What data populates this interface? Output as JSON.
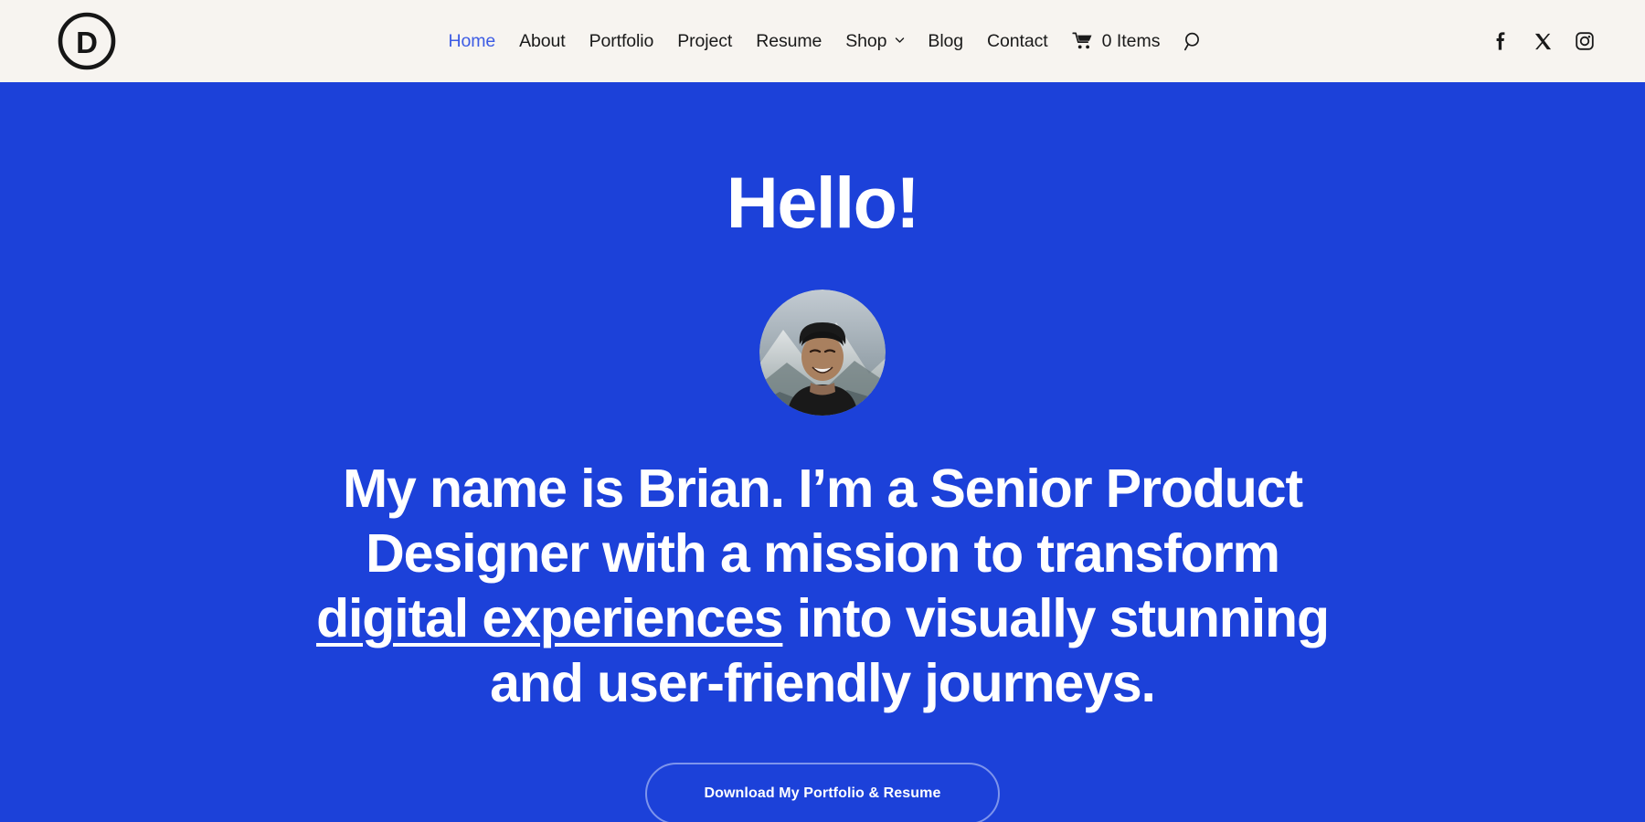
{
  "theme": {
    "hero_bg": "#1C41D9",
    "header_bg": "#F7F4F0",
    "accent_link": "#3D5CE4",
    "text_dark": "#1A1A1A",
    "text_light": "#FFFFFF",
    "cta_border": "#7D94EC"
  },
  "header": {
    "logo": {
      "name": "circle-d-logo",
      "letter": "D"
    },
    "nav_items": [
      {
        "label": "Home",
        "active": true,
        "has_dropdown": false
      },
      {
        "label": "About",
        "active": false,
        "has_dropdown": false
      },
      {
        "label": "Portfolio",
        "active": false,
        "has_dropdown": false
      },
      {
        "label": "Project",
        "active": false,
        "has_dropdown": false
      },
      {
        "label": "Resume",
        "active": false,
        "has_dropdown": false
      },
      {
        "label": "Shop",
        "active": false,
        "has_dropdown": true
      },
      {
        "label": "Blog",
        "active": false,
        "has_dropdown": false
      },
      {
        "label": "Contact",
        "active": false,
        "has_dropdown": false
      }
    ],
    "cart": {
      "icon": "cart-icon",
      "label": "0 Items",
      "count": 0
    },
    "search": {
      "icon": "search-icon"
    },
    "social": [
      {
        "icon": "facebook-icon",
        "label": "Facebook"
      },
      {
        "icon": "x-twitter-icon",
        "label": "X"
      },
      {
        "icon": "instagram-icon",
        "label": "Instagram"
      }
    ]
  },
  "hero": {
    "greeting": "Hello!",
    "avatar": {
      "icon": "avatar",
      "alt": "Portrait photo of Brian smiling outdoors with mountains behind"
    },
    "headline": {
      "part1": "My name is Brian. I’m a Senior Product Designer with a mission to transform ",
      "emphasis": "digital experiences",
      "part2": " into visually stunning and user-friendly journeys."
    },
    "cta": {
      "label": "Download My Portfolio & Resume"
    }
  }
}
